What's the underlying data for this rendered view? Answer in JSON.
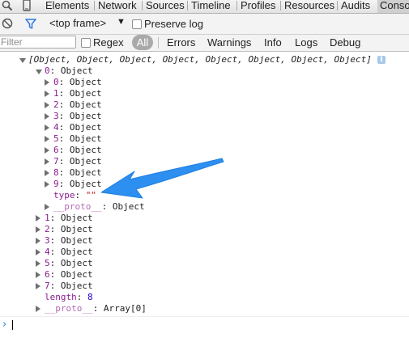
{
  "tabs": [
    "Elements",
    "Network",
    "Sources",
    "Timeline",
    "Profiles",
    "Resources",
    "Audits",
    "Conso"
  ],
  "framebar": {
    "frame_label": "<top frame>",
    "frame_arrow": "▼",
    "preserve_log": "Preserve log"
  },
  "filterbar": {
    "filter_placeholder": "Filter",
    "regex": "Regex",
    "all": "All",
    "levels": [
      "Errors",
      "Warnings",
      "Info",
      "Logs",
      "Debug"
    ]
  },
  "console": {
    "array_summary": "[Object, Object, Object, Object, Object, Object, Object, Object]",
    "info_badge": "i",
    "root_key": "0",
    "root_val": "Object",
    "nested_items": [
      {
        "key": "0",
        "val": "Object"
      },
      {
        "key": "1",
        "val": "Object"
      },
      {
        "key": "2",
        "val": "Object"
      },
      {
        "key": "3",
        "val": "Object"
      },
      {
        "key": "4",
        "val": "Object"
      },
      {
        "key": "5",
        "val": "Object"
      },
      {
        "key": "6",
        "val": "Object"
      },
      {
        "key": "7",
        "val": "Object"
      },
      {
        "key": "8",
        "val": "Object"
      },
      {
        "key": "9",
        "val": "Object"
      }
    ],
    "type_key": "type",
    "type_val": "\"\"",
    "proto_key": "__proto__",
    "proto_val": "Object",
    "outer_items": [
      {
        "key": "1",
        "val": "Object"
      },
      {
        "key": "2",
        "val": "Object"
      },
      {
        "key": "3",
        "val": "Object"
      },
      {
        "key": "4",
        "val": "Object"
      },
      {
        "key": "5",
        "val": "Object"
      },
      {
        "key": "6",
        "val": "Object"
      },
      {
        "key": "7",
        "val": "Object"
      }
    ],
    "length_key": "length",
    "length_val": "8",
    "array_proto_key": "__proto__",
    "array_proto_val": "Array[0]",
    "prompt": "›"
  },
  "colors": {
    "annotation_arrow": "#2d8ff0",
    "property_key": "#8b1b8f",
    "string_value": "#c41a16",
    "number_value": "#1c00cf",
    "prompt": "#2d7be0"
  },
  "icons": {
    "search": "search-icon",
    "mobile": "mobile-device-icon",
    "clear": "clear-console-icon",
    "filter": "filter-funnel-icon",
    "expand": "triangle-right-icon",
    "collapse": "triangle-down-icon"
  }
}
